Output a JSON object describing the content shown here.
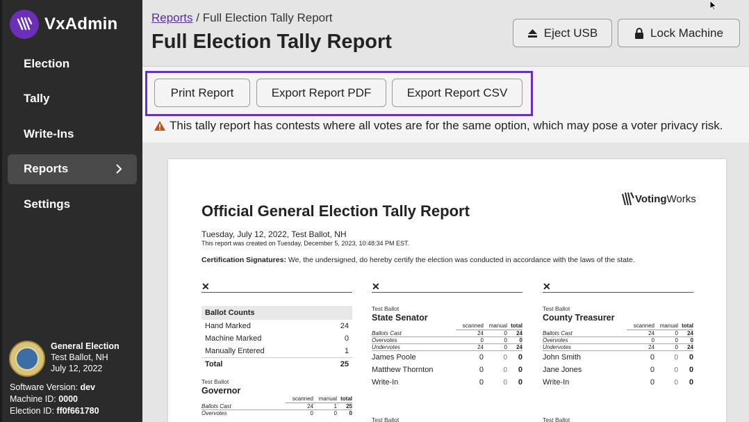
{
  "sidebar": {
    "brand": "VxAdmin",
    "items": [
      {
        "label": "Election"
      },
      {
        "label": "Tally"
      },
      {
        "label": "Write-Ins"
      },
      {
        "label": "Reports"
      },
      {
        "label": "Settings"
      }
    ],
    "active": "Reports",
    "election": {
      "title": "General Election",
      "line2": "Test Ballot, NH",
      "line3": "July 12, 2022"
    },
    "software_label": "Software Version:",
    "software_value": "dev",
    "machine_label": "Machine ID:",
    "machine_value": "0000",
    "election_id_label": "Election ID:",
    "election_id_value": "ff0f661780"
  },
  "header": {
    "breadcrumb_link": "Reports",
    "breadcrumb_sep": "/",
    "breadcrumb_current": "Full Election Tally Report",
    "title": "Full Election Tally Report",
    "eject_label": "Eject USB",
    "lock_label": "Lock Machine"
  },
  "actions": {
    "print_label": "Print Report",
    "pdf_label": "Export Report PDF",
    "csv_label": "Export Report CSV",
    "warning_text": "This tally report has contests where all votes are for the same option, which may pose a voter privacy risk."
  },
  "report": {
    "title": "Official General Election Tally Report",
    "logo_a": "Voting",
    "logo_b": "Works",
    "date_line": "Tuesday, July 12, 2022, Test Ballot, NH",
    "created_line": "This report was created on Tuesday, December 5, 2023, 10:48:34 PM EST.",
    "cert_label": "Certification Signatures:",
    "cert_text": "We, the undersigned, do hereby certify the election was conducted in accordance with the laws of the state.",
    "sig_mark": "✕",
    "ballot_counts": {
      "heading": "Ballot Counts",
      "rows": [
        {
          "label": "Hand Marked",
          "value": "24"
        },
        {
          "label": "Machine Marked",
          "value": "0"
        },
        {
          "label": "Manually Entered",
          "value": "1"
        }
      ],
      "total_label": "Total",
      "total_value": "25"
    },
    "col_headers": {
      "scanned": "scanned",
      "manual": "manual",
      "total": "total"
    },
    "governor": {
      "label": "Test Ballot",
      "title": "Governor",
      "stats": [
        {
          "label": "Ballots Cast",
          "scanned": "24",
          "manual": "1",
          "total": "25"
        },
        {
          "label": "Overvotes",
          "scanned": "0",
          "manual": "0",
          "total": "0"
        }
      ]
    },
    "senator": {
      "label": "Test Ballot",
      "title": "State Senator",
      "stats": [
        {
          "label": "Ballots Cast",
          "scanned": "24",
          "manual": "0",
          "total": "24"
        },
        {
          "label": "Overvotes",
          "scanned": "0",
          "manual": "0",
          "total": "0"
        },
        {
          "label": "Undervotes",
          "scanned": "24",
          "manual": "0",
          "total": "24"
        }
      ],
      "candidates": [
        {
          "name": "James Poole",
          "scanned": "0",
          "manual": "0",
          "total": "0"
        },
        {
          "name": "Matthew Thornton",
          "scanned": "0",
          "manual": "0",
          "total": "0"
        },
        {
          "name": "Write-In",
          "scanned": "0",
          "manual": "0",
          "total": "0"
        }
      ]
    },
    "treasurer": {
      "label": "Test Ballot",
      "title": "County Treasurer",
      "stats": [
        {
          "label": "Ballots Cast",
          "scanned": "24",
          "manual": "0",
          "total": "24"
        },
        {
          "label": "Overvotes",
          "scanned": "0",
          "manual": "0",
          "total": "0"
        },
        {
          "label": "Undervotes",
          "scanned": "24",
          "manual": "0",
          "total": "24"
        }
      ],
      "candidates": [
        {
          "name": "John Smith",
          "scanned": "0",
          "manual": "0",
          "total": "0"
        },
        {
          "name": "Jane Jones",
          "scanned": "0",
          "manual": "0",
          "total": "0"
        },
        {
          "name": "Write-In",
          "scanned": "0",
          "manual": "0",
          "total": "0"
        }
      ]
    },
    "next_label_1": "Test Ballot",
    "next_label_2": "Test Ballot"
  },
  "colors": {
    "accent": "#6c2fb8",
    "sidebar": "#2b2b2b",
    "warning": "#c0501a"
  }
}
